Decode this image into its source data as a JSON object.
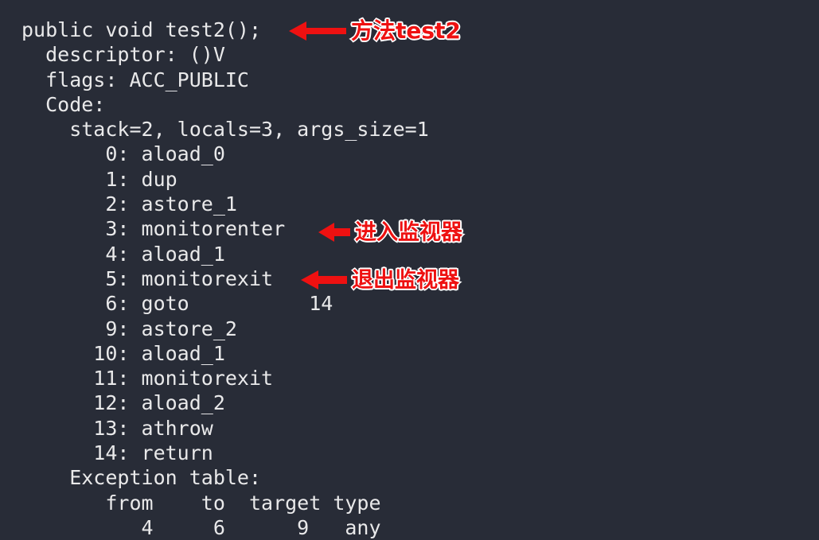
{
  "terminal": {
    "background_color": "#282c37",
    "text_color": "#e9e9ea"
  },
  "code": {
    "language": "java-bytecode",
    "lines": [
      "public void test2();",
      "  descriptor: ()V",
      "  flags: ACC_PUBLIC",
      "  Code:",
      "    stack=2, locals=3, args_size=1",
      "       0: aload_0",
      "       1: dup",
      "       2: astore_1",
      "       3: monitorenter",
      "       4: aload_1",
      "       5: monitorexit",
      "       6: goto          14",
      "       9: astore_2",
      "      10: aload_1",
      "      11: monitorexit",
      "      12: aload_2",
      "      13: athrow",
      "      14: return",
      "    Exception table:",
      "       from    to  target type",
      "          4     6      9   any"
    ]
  },
  "annotations": {
    "color": "#ee1111",
    "outline_color": "#ffffff",
    "items": [
      {
        "id": "method",
        "label": "方法test2",
        "points_to": "public void test2();",
        "arrow_direction": "left"
      },
      {
        "id": "enter",
        "label": "进入监视器",
        "points_to": "3: monitorenter",
        "arrow_direction": "left"
      },
      {
        "id": "exit",
        "label": "退出监视器",
        "points_to": "5: monitorexit",
        "arrow_direction": "left"
      }
    ]
  }
}
